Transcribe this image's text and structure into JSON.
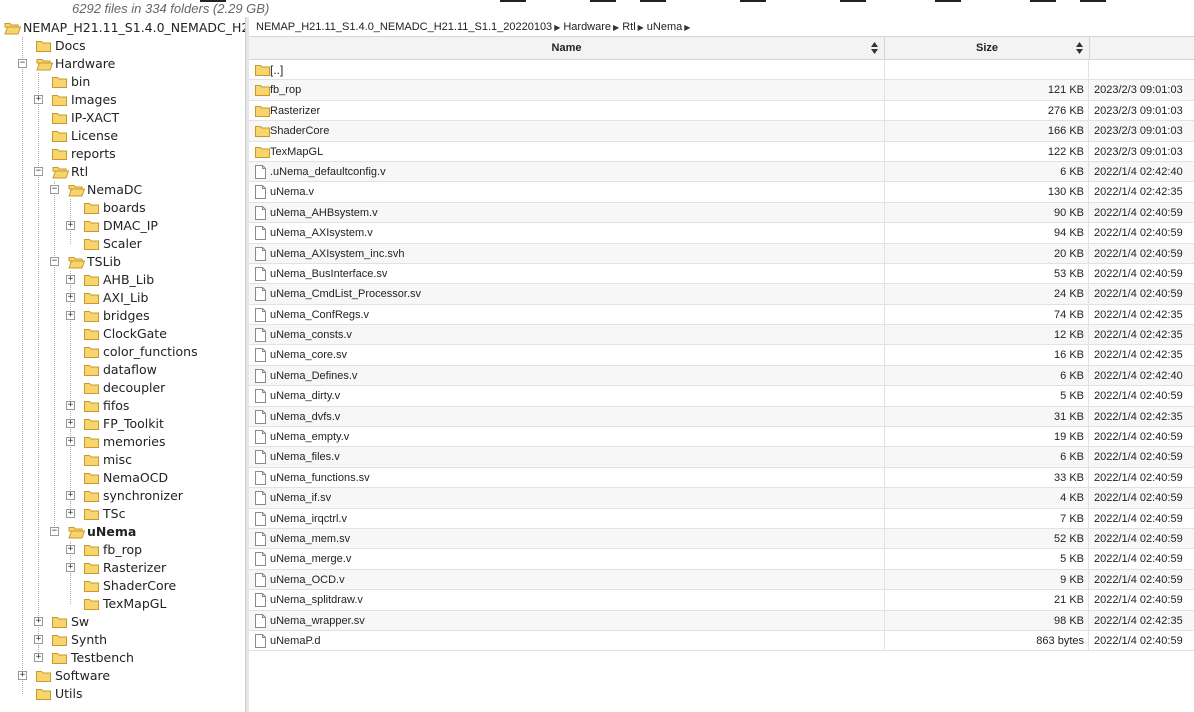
{
  "summary": "6292 files in 334 folders (2.29 GB)",
  "tree": [
    {
      "label": "NEMAP_H21.11_S1.4.0_NEMADC_H2",
      "depth": 0,
      "open": true,
      "exp": "none"
    },
    {
      "label": "Docs",
      "depth": 1,
      "exp": "none"
    },
    {
      "label": "Hardware",
      "depth": 1,
      "open": true,
      "exp": "minus"
    },
    {
      "label": "bin",
      "depth": 2,
      "exp": "none"
    },
    {
      "label": "Images",
      "depth": 2,
      "exp": "plus"
    },
    {
      "label": "IP-XACT",
      "depth": 2,
      "exp": "none"
    },
    {
      "label": "License",
      "depth": 2,
      "exp": "none"
    },
    {
      "label": "reports",
      "depth": 2,
      "exp": "none"
    },
    {
      "label": "Rtl",
      "depth": 2,
      "open": true,
      "exp": "minus"
    },
    {
      "label": "NemaDC",
      "depth": 3,
      "open": true,
      "exp": "minus"
    },
    {
      "label": "boards",
      "depth": 4,
      "exp": "none"
    },
    {
      "label": "DMAC_IP",
      "depth": 4,
      "exp": "plus"
    },
    {
      "label": "Scaler",
      "depth": 4,
      "exp": "none"
    },
    {
      "label": "TSLib",
      "depth": 3,
      "open": true,
      "exp": "minus"
    },
    {
      "label": "AHB_Lib",
      "depth": 4,
      "exp": "plus"
    },
    {
      "label": "AXI_Lib",
      "depth": 4,
      "exp": "plus"
    },
    {
      "label": "bridges",
      "depth": 4,
      "exp": "plus"
    },
    {
      "label": "ClockGate",
      "depth": 4,
      "exp": "none"
    },
    {
      "label": "color_functions",
      "depth": 4,
      "exp": "none"
    },
    {
      "label": "dataflow",
      "depth": 4,
      "exp": "none"
    },
    {
      "label": "decoupler",
      "depth": 4,
      "exp": "none"
    },
    {
      "label": "fifos",
      "depth": 4,
      "exp": "plus"
    },
    {
      "label": "FP_Toolkit",
      "depth": 4,
      "exp": "plus"
    },
    {
      "label": "memories",
      "depth": 4,
      "exp": "plus"
    },
    {
      "label": "misc",
      "depth": 4,
      "exp": "none"
    },
    {
      "label": "NemaOCD",
      "depth": 4,
      "exp": "none"
    },
    {
      "label": "synchronizer",
      "depth": 4,
      "exp": "plus"
    },
    {
      "label": "TSc",
      "depth": 4,
      "exp": "plus"
    },
    {
      "label": "uNema",
      "depth": 3,
      "open": true,
      "exp": "minus",
      "bold": true
    },
    {
      "label": "fb_rop",
      "depth": 4,
      "exp": "plus"
    },
    {
      "label": "Rasterizer",
      "depth": 4,
      "exp": "plus"
    },
    {
      "label": "ShaderCore",
      "depth": 4,
      "exp": "none"
    },
    {
      "label": "TexMapGL",
      "depth": 4,
      "exp": "none"
    },
    {
      "label": "Sw",
      "depth": 2,
      "exp": "plus"
    },
    {
      "label": "Synth",
      "depth": 2,
      "exp": "plus"
    },
    {
      "label": "Testbench",
      "depth": 2,
      "exp": "plus"
    },
    {
      "label": "Software",
      "depth": 1,
      "exp": "plus"
    },
    {
      "label": "Utils",
      "depth": 1,
      "exp": "none"
    }
  ],
  "breadcrumb": [
    "NEMAP_H21.11_S1.4.0_NEMADC_H21.11_S1.1_20220103",
    "Hardware",
    "Rtl",
    "uNema"
  ],
  "breadcrumb_sep": "▶",
  "columns": {
    "name": "Name",
    "size": "Size",
    "date": ""
  },
  "files": [
    {
      "name": "[..]",
      "size": "",
      "date": "",
      "type": "up"
    },
    {
      "name": "fb_rop",
      "size": "121 KB",
      "date": "2023/2/3 09:01:03",
      "type": "folder"
    },
    {
      "name": "Rasterizer",
      "size": "276 KB",
      "date": "2023/2/3 09:01:03",
      "type": "folder"
    },
    {
      "name": "ShaderCore",
      "size": "166 KB",
      "date": "2023/2/3 09:01:03",
      "type": "folder"
    },
    {
      "name": "TexMapGL",
      "size": "122 KB",
      "date": "2023/2/3 09:01:03",
      "type": "folder"
    },
    {
      "name": ".uNema_defaultconfig.v",
      "size": "6 KB",
      "date": "2022/1/4 02:42:40",
      "type": "file"
    },
    {
      "name": "uNema.v",
      "size": "130 KB",
      "date": "2022/1/4 02:42:35",
      "type": "file"
    },
    {
      "name": "uNema_AHBsystem.v",
      "size": "90 KB",
      "date": "2022/1/4 02:40:59",
      "type": "file"
    },
    {
      "name": "uNema_AXIsystem.v",
      "size": "94 KB",
      "date": "2022/1/4 02:40:59",
      "type": "file"
    },
    {
      "name": "uNema_AXIsystem_inc.svh",
      "size": "20 KB",
      "date": "2022/1/4 02:40:59",
      "type": "file"
    },
    {
      "name": "uNema_BusInterface.sv",
      "size": "53 KB",
      "date": "2022/1/4 02:40:59",
      "type": "file"
    },
    {
      "name": "uNema_CmdList_Processor.sv",
      "size": "24 KB",
      "date": "2022/1/4 02:40:59",
      "type": "file"
    },
    {
      "name": "uNema_ConfRegs.v",
      "size": "74 KB",
      "date": "2022/1/4 02:42:35",
      "type": "file"
    },
    {
      "name": "uNema_consts.v",
      "size": "12 KB",
      "date": "2022/1/4 02:42:35",
      "type": "file"
    },
    {
      "name": "uNema_core.sv",
      "size": "16 KB",
      "date": "2022/1/4 02:42:35",
      "type": "file"
    },
    {
      "name": "uNema_Defines.v",
      "size": "6 KB",
      "date": "2022/1/4 02:42:40",
      "type": "file"
    },
    {
      "name": "uNema_dirty.v",
      "size": "5 KB",
      "date": "2022/1/4 02:40:59",
      "type": "file"
    },
    {
      "name": "uNema_dvfs.v",
      "size": "31 KB",
      "date": "2022/1/4 02:42:35",
      "type": "file"
    },
    {
      "name": "uNema_empty.v",
      "size": "19 KB",
      "date": "2022/1/4 02:40:59",
      "type": "file"
    },
    {
      "name": "uNema_files.v",
      "size": "6 KB",
      "date": "2022/1/4 02:40:59",
      "type": "file"
    },
    {
      "name": "uNema_functions.sv",
      "size": "33 KB",
      "date": "2022/1/4 02:40:59",
      "type": "file"
    },
    {
      "name": "uNema_if.sv",
      "size": "4 KB",
      "date": "2022/1/4 02:40:59",
      "type": "file"
    },
    {
      "name": "uNema_irqctrl.v",
      "size": "7 KB",
      "date": "2022/1/4 02:40:59",
      "type": "file"
    },
    {
      "name": "uNema_mem.sv",
      "size": "52 KB",
      "date": "2022/1/4 02:40:59",
      "type": "file"
    },
    {
      "name": "uNema_merge.v",
      "size": "5 KB",
      "date": "2022/1/4 02:40:59",
      "type": "file"
    },
    {
      "name": "uNema_OCD.v",
      "size": "9 KB",
      "date": "2022/1/4 02:40:59",
      "type": "file"
    },
    {
      "name": "uNema_splitdraw.v",
      "size": "21 KB",
      "date": "2022/1/4 02:40:59",
      "type": "file"
    },
    {
      "name": "uNema_wrapper.sv",
      "size": "98 KB",
      "date": "2022/1/4 02:42:35",
      "type": "file"
    },
    {
      "name": "uNemaP.d",
      "size": "863 bytes",
      "date": "2022/1/4 02:40:59",
      "type": "file"
    }
  ],
  "colors": {
    "folder_fill": "#f7d46e",
    "folder_stroke": "#c89a2a",
    "file_stroke": "#8a8a8a"
  }
}
